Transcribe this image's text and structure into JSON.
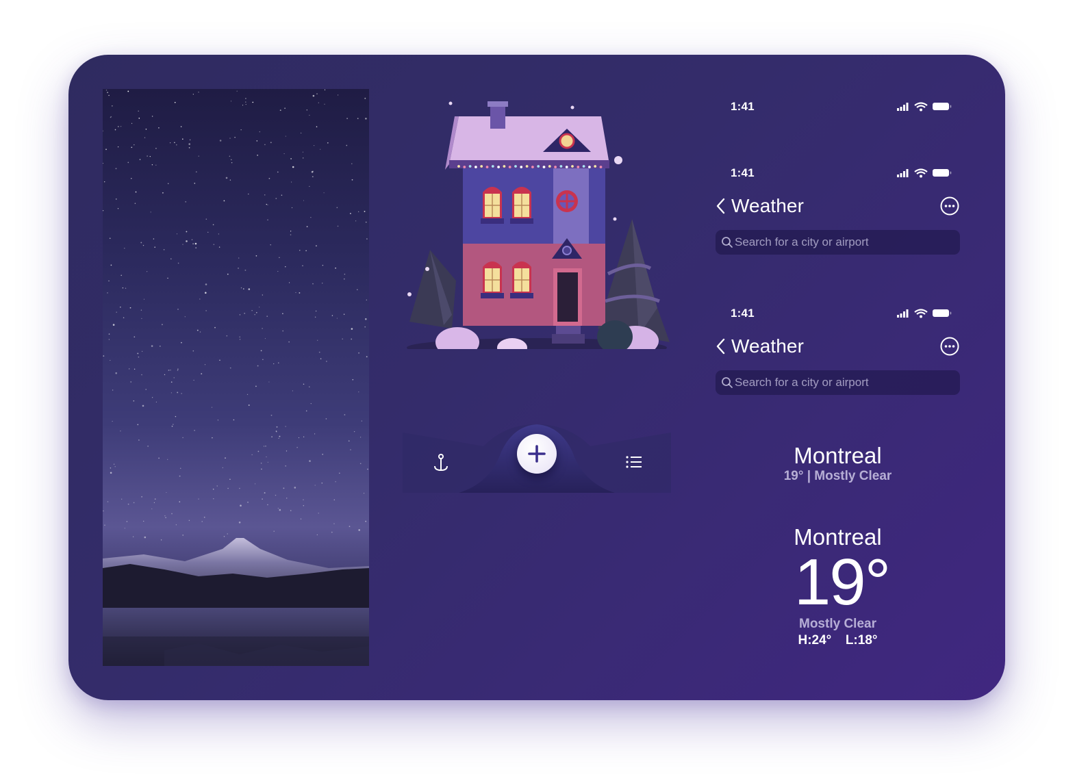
{
  "status_bars": [
    {
      "time": "1:41"
    },
    {
      "time": "1:41"
    },
    {
      "time": "1:41"
    }
  ],
  "nav_bars": [
    {
      "title": "Weather",
      "back_icon": "chevron-left-icon",
      "more_icon": "ellipsis-circle-icon"
    },
    {
      "title": "Weather",
      "back_icon": "chevron-left-icon",
      "more_icon": "ellipsis-circle-icon"
    }
  ],
  "search_bars": [
    {
      "placeholder": "Search for a city or airport"
    },
    {
      "placeholder": "Search for a city or airport"
    }
  ],
  "compact_header": {
    "city": "Montreal",
    "summary": "19° | Mostly Clear"
  },
  "large_header": {
    "city": "Montreal",
    "temperature": "19°",
    "condition": "Mostly Clear",
    "high": "H:24°",
    "low": "L:18°"
  },
  "tab_bar": {
    "left_icon": "map-pin-icon",
    "center_icon": "plus-icon",
    "right_icon": "list-icon"
  },
  "colors": {
    "card_background": "#342c6b",
    "accent": "#3b2f8c",
    "text_primary": "#ffffff"
  }
}
